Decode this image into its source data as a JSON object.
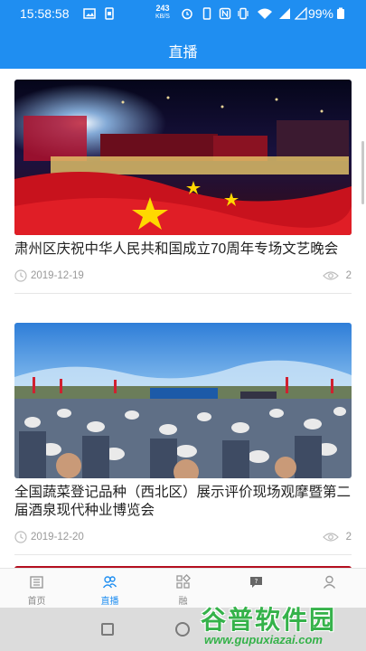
{
  "status_bar": {
    "time": "15:58:58",
    "net_speed": "243",
    "net_unit": "KB/S",
    "battery": "99%"
  },
  "header": {
    "title": "直播"
  },
  "items": [
    {
      "title": "肃州区庆祝中华人民共和国成立70周年专场文艺晚会",
      "date": "2019-12-19",
      "views": "2"
    },
    {
      "title": "全国蔬菜登记品种（西北区）展示评价现场观摩暨第二届酒泉现代种业博览会",
      "date": "2019-12-20",
      "views": "2"
    }
  ],
  "tabs": [
    {
      "label": "首页",
      "icon": "building-icon"
    },
    {
      "label": "直播",
      "icon": "people-icon",
      "active": true
    },
    {
      "label": "融",
      "icon": "grid-icon"
    },
    {
      "label": "",
      "icon": "message-icon"
    },
    {
      "label": "",
      "icon": "user-icon"
    }
  ],
  "watermark": {
    "text": "谷普软件园",
    "url": "www.gupuxiazai.com"
  },
  "colors": {
    "primary": "#1f8ef1",
    "watermark": "#35b24a"
  }
}
